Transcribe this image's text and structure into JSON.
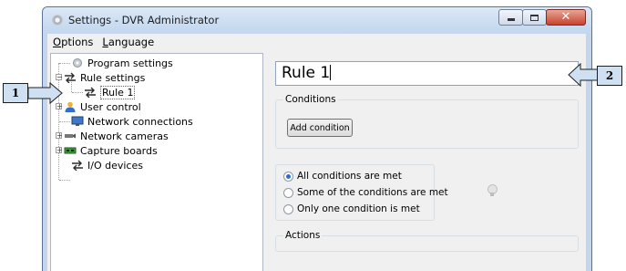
{
  "window": {
    "title": "Settings - DVR Administrator",
    "controls": {
      "minimize_icon": "minimize-icon",
      "maximize_icon": "maximize-icon",
      "close_icon": "close-icon",
      "close_glyph": "✕"
    }
  },
  "menu": {
    "options": {
      "underlined": "O",
      "rest": "ptions"
    },
    "language": {
      "underlined": "L",
      "rest": "anguage"
    }
  },
  "tree": {
    "items": [
      {
        "label": "Program settings",
        "icon": "gear-icon"
      },
      {
        "label": "Rule settings",
        "icon": "rules-arrows-icon"
      },
      {
        "label": "Rule 1",
        "icon": "rules-arrows-icon",
        "selected": true
      },
      {
        "label": "User control",
        "icon": "user-icon"
      },
      {
        "label": "Network connections",
        "icon": "monitor-icon"
      },
      {
        "label": "Network cameras",
        "icon": "camera-icon"
      },
      {
        "label": "Capture boards",
        "icon": "capture-board-icon"
      },
      {
        "label": "I/O devices",
        "icon": "rules-arrows-icon"
      }
    ]
  },
  "rule": {
    "name": "Rule 1"
  },
  "conditions": {
    "group_label": "Conditions",
    "add_button": "Add condition",
    "mode_options": [
      {
        "label": "All conditions are met",
        "selected": true
      },
      {
        "label": "Some of the conditions are met",
        "selected": false
      },
      {
        "label": "Only one condition is met",
        "selected": false
      }
    ],
    "hint_icon": "lightbulb-icon"
  },
  "actions": {
    "group_label": "Actions"
  },
  "callouts": [
    {
      "number": "1"
    },
    {
      "number": "2"
    }
  ],
  "colors": {
    "callout_fill": "#cfe0f3",
    "selection": "#3399ff",
    "radio_selected": "#2a6fcf",
    "close_button": "#c7432c"
  }
}
